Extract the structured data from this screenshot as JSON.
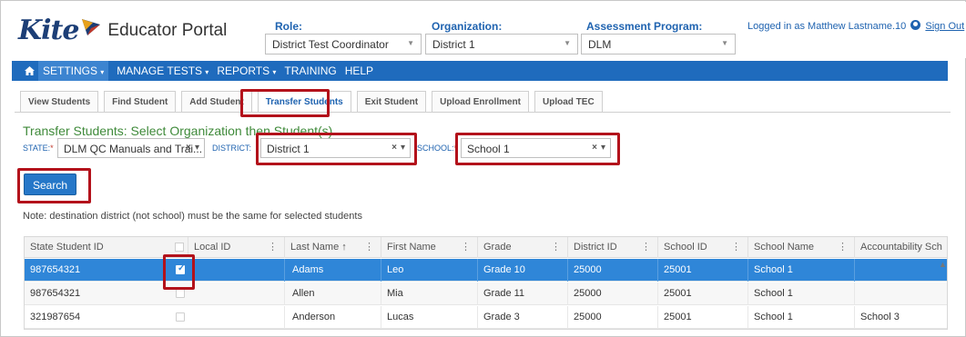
{
  "header": {
    "logo_text": "Kite",
    "portal_text": "Educator Portal",
    "role": {
      "label": "Role:",
      "value": "District Test Coordinator"
    },
    "organization": {
      "label": "Organization:",
      "value": "District 1"
    },
    "assessment_program": {
      "label": "Assessment Program:",
      "value": "DLM"
    },
    "login_text": "Logged in as Matthew Lastname.10",
    "sign_out": "Sign Out"
  },
  "nav": {
    "items": [
      {
        "label": "SETTINGS",
        "dropdown": true,
        "active": true
      },
      {
        "label": "MANAGE TESTS",
        "dropdown": true
      },
      {
        "label": "REPORTS",
        "dropdown": true
      },
      {
        "label": "TRAINING",
        "dropdown": false
      },
      {
        "label": "HELP",
        "dropdown": false
      }
    ]
  },
  "tabs": [
    {
      "label": "View Students"
    },
    {
      "label": "Find Student"
    },
    {
      "label": "Add Student"
    },
    {
      "label": "Transfer Students",
      "active": true
    },
    {
      "label": "Exit Student"
    },
    {
      "label": "Upload Enrollment"
    },
    {
      "label": "Upload TEC"
    }
  ],
  "transfer": {
    "title": "Transfer Students: Select Organization then Student(s)",
    "state_label": "STATE:",
    "state_value": "DLM QC Manuals and Trai...",
    "district_label": "DISTRICT:",
    "district_value": "District 1",
    "school_label": "SCHOOL:",
    "school_value": "School 1",
    "required_mark": "*",
    "search_label": "Search",
    "note": "Note: destination district (not school) must be the same for selected students"
  },
  "grid": {
    "columns": [
      "State Student ID",
      "",
      "Local ID",
      "Last Name ↑",
      "First Name",
      "Grade",
      "District ID",
      "School ID",
      "School Name",
      "Accountability Sch"
    ],
    "rows": [
      {
        "state_id": "987654321",
        "checked": true,
        "local_id": "",
        "last": "Adams",
        "first": "Leo",
        "grade": "Grade 10",
        "district_id": "25000",
        "school_id": "25001",
        "school_name": "School 1",
        "acct": ""
      },
      {
        "state_id": "987654321",
        "checked": false,
        "local_id": "",
        "last": "Allen",
        "first": "Mia",
        "grade": "Grade 11",
        "district_id": "25000",
        "school_id": "25001",
        "school_name": "School 1",
        "acct": ""
      },
      {
        "state_id": "321987654",
        "checked": false,
        "local_id": "",
        "last": "Anderson",
        "first": "Lucas",
        "grade": "Grade 3",
        "district_id": "25000",
        "school_id": "25001",
        "school_name": "School 1",
        "acct": "School 3"
      }
    ]
  },
  "colors": {
    "brand_blue": "#1f6bbd",
    "highlight_red": "#b3121b",
    "title_green": "#3f8a3a",
    "selected_row": "#2f86d8"
  }
}
